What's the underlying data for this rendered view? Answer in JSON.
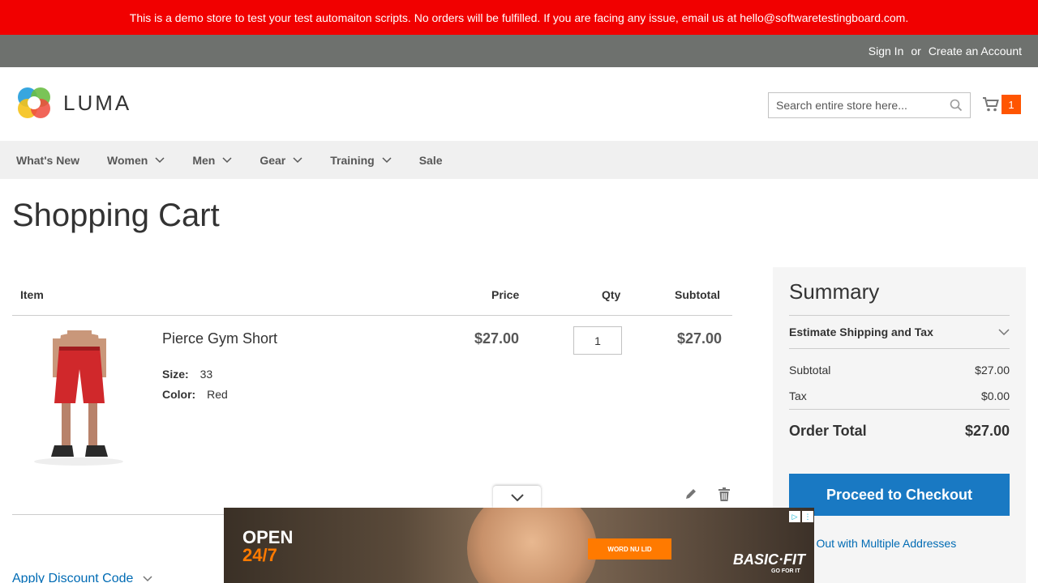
{
  "demo_notice": "This is a demo store to test your test automaiton scripts. No orders will be fulfilled. If you are facing any issue, email us at hello@softwaretestingboard.com.",
  "top_links": {
    "sign_in": "Sign In",
    "or": "or",
    "create_account": "Create an Account"
  },
  "logo": {
    "text": "LUMA"
  },
  "search": {
    "placeholder": "Search entire store here..."
  },
  "minicart": {
    "count": "1"
  },
  "nav": {
    "items": [
      "What's New",
      "Women",
      "Men",
      "Gear",
      "Training",
      "Sale"
    ]
  },
  "page_title": "Shopping Cart",
  "cart_table": {
    "headers": {
      "item": "Item",
      "price": "Price",
      "qty": "Qty",
      "subtotal": "Subtotal"
    },
    "row": {
      "name": "Pierce Gym Short",
      "size_label": "Size:",
      "size_value": "33",
      "color_label": "Color:",
      "color_value": "Red",
      "price": "$27.00",
      "qty": "1",
      "subtotal": "$27.00"
    }
  },
  "discount": {
    "label": "Apply Discount Code"
  },
  "summary": {
    "title": "Summary",
    "estimate": "Estimate Shipping and Tax",
    "subtotal_label": "Subtotal",
    "subtotal_value": "$27.00",
    "tax_label": "Tax",
    "tax_value": "$0.00",
    "total_label": "Order Total",
    "total_value": "$27.00",
    "checkout_label": "Proceed to Checkout",
    "multi_label": "heck Out with Multiple Addresses"
  },
  "ad": {
    "line1": "OPEN",
    "line2": "24/7",
    "button": "WORD NU LID",
    "brand": "BASIC·FIT",
    "tagline": "GO FOR IT"
  },
  "colors": {
    "demo_bar": "#f10000",
    "top_links": "#6e716e",
    "accent": "#1979c3",
    "cart_badge": "#ff5501",
    "link": "#006bb4"
  }
}
